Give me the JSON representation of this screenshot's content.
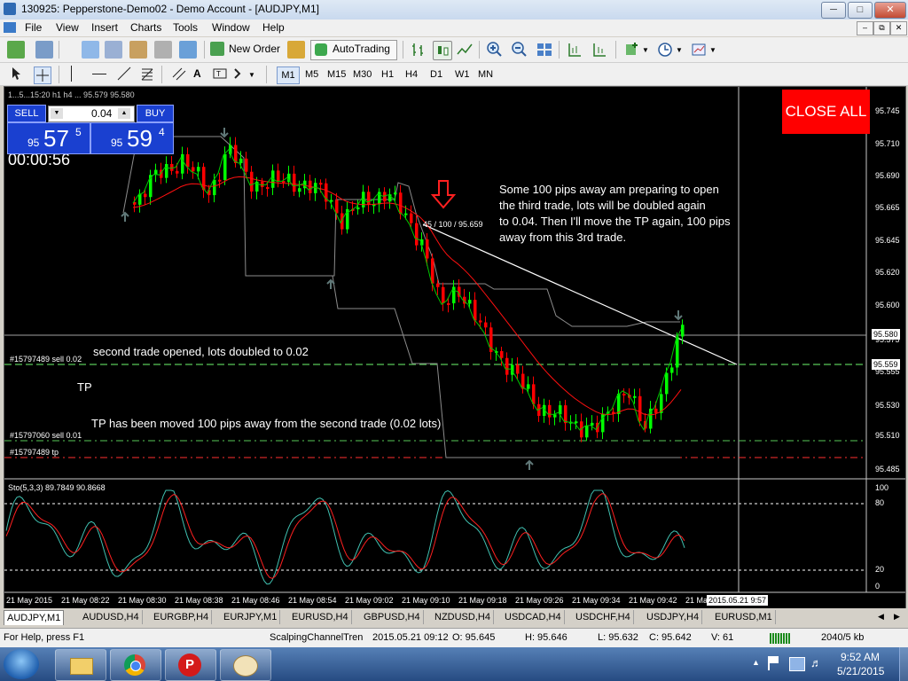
{
  "window": {
    "title": "130925: Pepperstone-Demo02 - Demo Account - [AUDJPY,M1]"
  },
  "menu": [
    "File",
    "View",
    "Insert",
    "Charts",
    "Tools",
    "Window",
    "Help"
  ],
  "toolbar": {
    "new_order_label": "New Order",
    "autotrading_label": "AutoTrading"
  },
  "timeframes": [
    "M1",
    "M5",
    "M15",
    "M30",
    "H1",
    "H4",
    "D1",
    "W1",
    "MN"
  ],
  "chart": {
    "info_line": "1...5...15:20  h1 h4 ... 95.579 95.580",
    "timer": "00:00:56",
    "close_all_label": "CLOSE ALL",
    "oneclick": {
      "sell_label": "SELL",
      "buy_label": "BUY",
      "lot": "0.04",
      "sell_prefix": "95",
      "sell_big": "57",
      "sell_sup": "5",
      "buy_prefix": "95",
      "buy_big": "59",
      "buy_sup": "4"
    },
    "trendline_label": "45 / 100 / 95.659",
    "annotations": {
      "third_trade": [
        "Some 100 pips away am preparing to open",
        "the third trade, lots will be doubled again",
        "to 0.04. Then I'll move the TP again, 100 pips",
        "away from this 3rd trade."
      ],
      "second_trade": "second trade opened, lots doubled to 0.02",
      "tp": "TP",
      "tp_moved": "TP has been moved 100 pips away from the second trade (0.02 lots)"
    },
    "order_labels": {
      "sell_002": "#15797489 sell 0.02",
      "sell_001": "#15797060 sell 0.01",
      "tp": "#15797489 tp"
    },
    "price_axis": [
      "95.745",
      "95.710",
      "95.690",
      "95.665",
      "95.645",
      "95.620",
      "95.600",
      "95.575",
      "95.555",
      "95.530",
      "95.510",
      "95.485"
    ],
    "current_price_tag": "95.580",
    "order_price_tag": "95.559",
    "stoch_label": "Sto(5,3,3) 89.7849 90.8668",
    "stoch_axis": [
      "100",
      "80",
      "20",
      "0"
    ],
    "time_axis": [
      "21 May 2015",
      "21 May 08:22",
      "21 May 08:30",
      "21 May 08:38",
      "21 May 08:46",
      "21 May 08:54",
      "21 May 09:02",
      "21 May 09:10",
      "21 May 09:18",
      "21 May 09:26",
      "21 May 09:34",
      "21 May 09:42",
      "21 Ma"
    ],
    "time_tag": "2015.05.21 9:57",
    "colors": {
      "bull": "#00ff00",
      "bear": "#ff0000",
      "ma_fast": "#00c800",
      "ma_slow": "#ff0000",
      "channel": "#8c8c8c",
      "stoch_main": "#40c0b0",
      "stoch_signal": "#ff2020"
    }
  },
  "tabs": [
    "AUDJPY,M1",
    "AUDUSD,H4",
    "EURGBP,H4",
    "EURJPY,M1",
    "EURUSD,H4",
    "GBPUSD,H4",
    "NZDUSD,H4",
    "USDCAD,H4",
    "USDCHF,H4",
    "USDJPY,H4",
    "EURUSD,M1"
  ],
  "status": {
    "help": "For Help, press F1",
    "profile": "ScalpingChannelTren",
    "datetime": "2015.05.21 09:12",
    "open": "O: 95.645",
    "high": "H: 95.646",
    "low": "L: 95.632",
    "close": "C: 95.642",
    "volume": "V: 61",
    "traffic": "2040/5 kb"
  },
  "taskbar": {
    "time": "9:52 AM",
    "date": "5/21/2015"
  }
}
